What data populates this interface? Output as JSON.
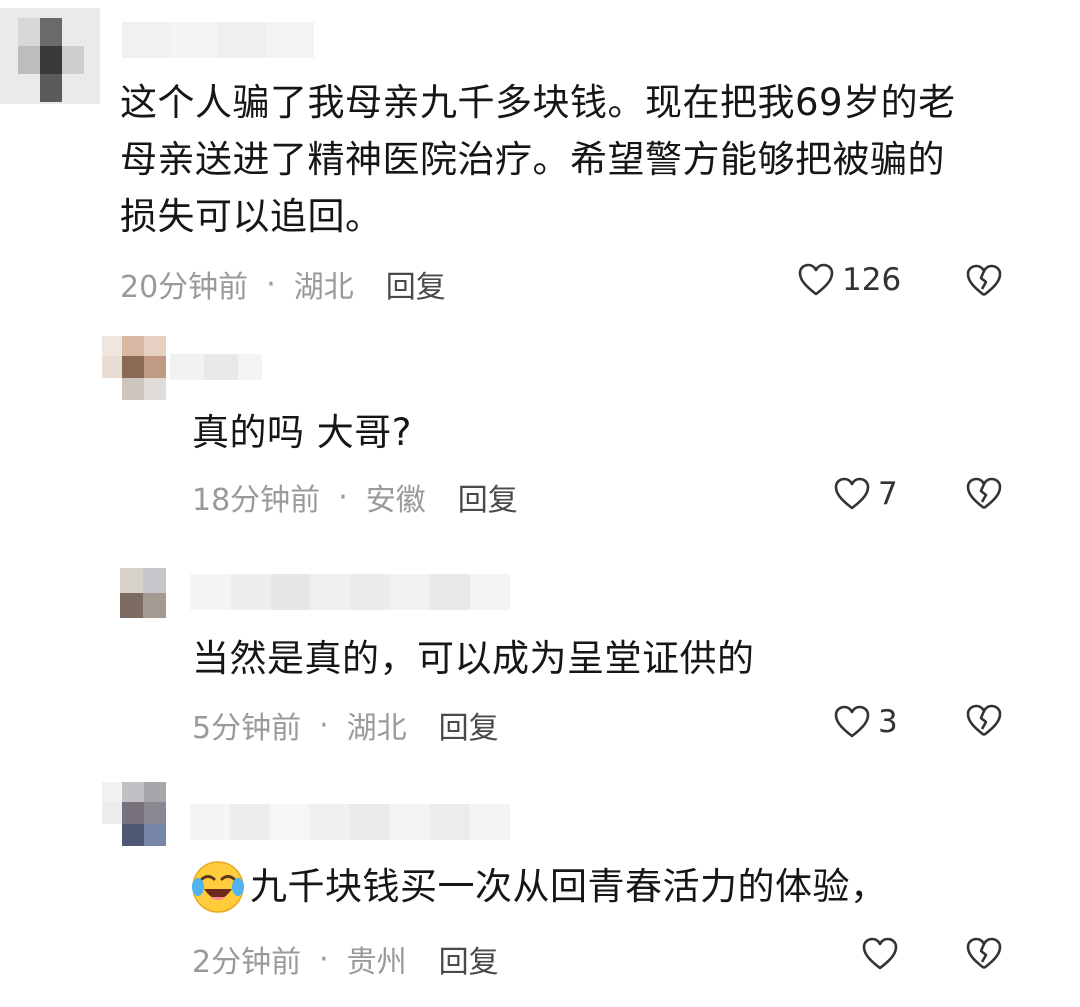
{
  "comments": [
    {
      "text": "这个人骗了我母亲九千多块钱。现在把我69岁的老母亲送进了精神医院治疗。希望警方能够把被骗的损失可以追回。",
      "lines": [
        "这个人骗了我母亲九千多块钱。现在把我69岁的老",
        "母亲送进了精神医院治疗。希望警方能够把被骗的",
        "损失可以追回。"
      ],
      "time": "20分钟前",
      "location": "湖北",
      "reply_label": "回复",
      "likes": "126"
    },
    {
      "text": "真的吗 大哥?",
      "time": "18分钟前",
      "location": "安徽",
      "reply_label": "回复",
      "likes": "7"
    },
    {
      "text": "当然是真的，可以成为呈堂证供的",
      "time": "5分钟前",
      "location": "湖北",
      "reply_label": "回复",
      "likes": "3"
    },
    {
      "emoji": "laughing-crying-emoji",
      "text": "九千块钱买一次从回青春活力的体验，",
      "time": "2分钟前",
      "location": "贵州",
      "reply_label": "回复",
      "likes": ""
    }
  ],
  "separator": "·",
  "icons": {
    "like": "heart-outline-icon",
    "dislike": "broken-heart-icon"
  },
  "colors": {
    "meta": "#9a9a9a",
    "text": "#161616",
    "reply": "#4a4a4a"
  }
}
